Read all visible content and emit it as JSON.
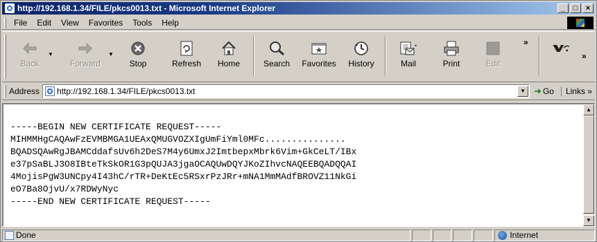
{
  "window": {
    "title": "http://192.168.1.34/FILE/pkcs0013.txt - Microsoft Internet Explorer",
    "controls": [
      "_",
      "□",
      "×"
    ]
  },
  "menu": {
    "items": [
      "File",
      "Edit",
      "View",
      "Favorites",
      "Tools",
      "Help"
    ]
  },
  "toolbar": {
    "back": "Back",
    "forward": "Forward",
    "stop": "Stop",
    "refresh": "Refresh",
    "home": "Home",
    "search": "Search",
    "favorites": "Favorites",
    "history": "History",
    "mail": "Mail",
    "print": "Print",
    "edit": "Edit",
    "overflow": "»"
  },
  "address": {
    "label": "Address",
    "value": "http://192.168.1.34/FILE/pkcs0013.txt",
    "go": "Go",
    "links": "Links »"
  },
  "content": {
    "lines": [
      "-----BEGIN NEW CERTIFICATE REQUEST-----",
      "MIHMMHgCAQAwFzEVMBMGA1UEAxQMUGVOZXIgUmFiYml0MFc...............",
      "BQADSQAwRgJBAMCddafsUv6h2DeS7M4y6UmxJ2ImtbepxMbrk6Vim+GkCeLT/IBx",
      "e37pSaBLJ3O8IBteTkSkOR1G3pQUJA3jgaOCAQUwDQYJKoZIhvcNAQEEBQADQQAI",
      "4MojisPgW3UNCpy4I43hC/rTR+DeKtEc5RSxrPzJRr+mNA1MmMAdfBROVZ11NkGi",
      "eO7Ba8OjvU/x7RDWyNyc",
      "-----END NEW CERTIFICATE REQUEST-----"
    ]
  },
  "status": {
    "text": "Done",
    "zone": "Internet"
  }
}
